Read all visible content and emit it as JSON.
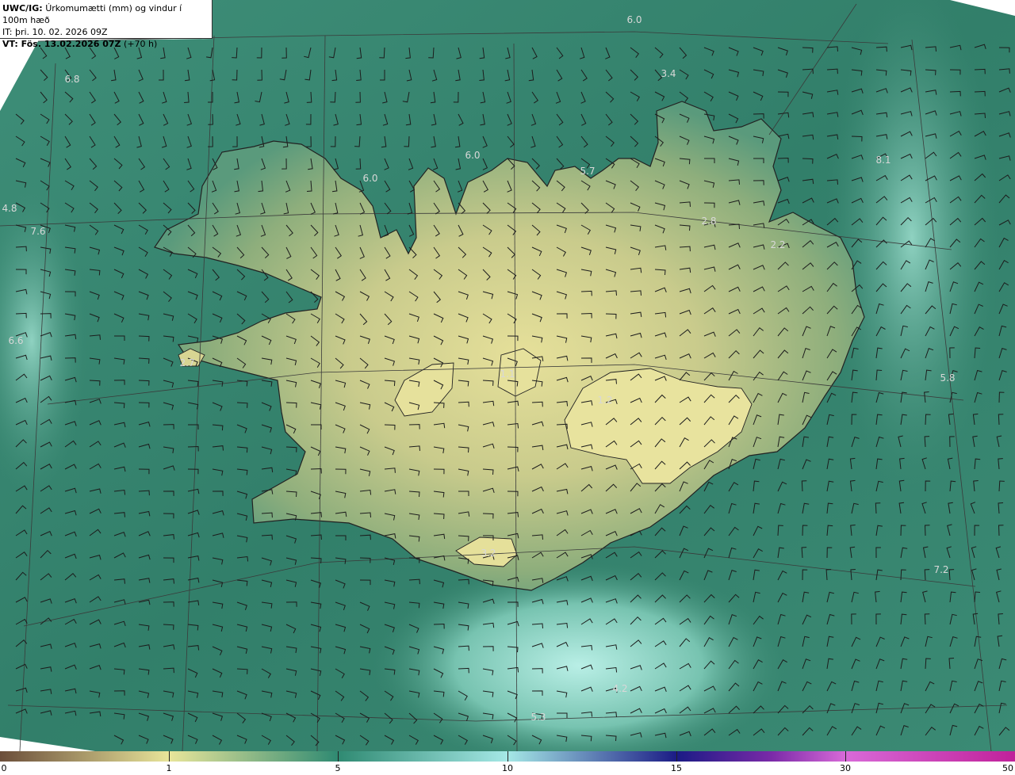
{
  "header": {
    "model": "UWC/IG:",
    "title": "Úrkomumætti (mm) og vindur í 100m hæð",
    "it_line": "IT: þri. 10. 02. 2026 09Z",
    "vt_prefix": "VT: Fös. 13.02.2026 07Z",
    "vt_suffix": "(+70 h)"
  },
  "value_labels": [
    "6.0",
    "6.8",
    "3.4",
    "6.0",
    "5.7",
    "6.0",
    "8.1",
    "4.8",
    "7.6",
    "2.8",
    "2.2",
    "6.6",
    "2.7",
    "1.1",
    "1.2",
    "5.8",
    "3.2",
    "7.2",
    "5.3",
    "4.2"
  ],
  "colorbar": {
    "ticks": [
      "0",
      "1",
      "5",
      "10",
      "15",
      "30",
      "50"
    ],
    "colors": [
      "#6b4e3a",
      "#a88e6c",
      "#e8e59a",
      "#2f8a72",
      "#a5e8e6",
      "#1b1b85",
      "#7a2aa8",
      "#d86ad8",
      "#c0219a"
    ]
  },
  "colors": {
    "sea": "#3f8d76",
    "land_low": "#8fae7a",
    "land_high": "#e3df98",
    "coast": "#222222",
    "grid": "#3a3a3a",
    "barb": "#1c1c1c",
    "white_area": "#ffffff"
  }
}
